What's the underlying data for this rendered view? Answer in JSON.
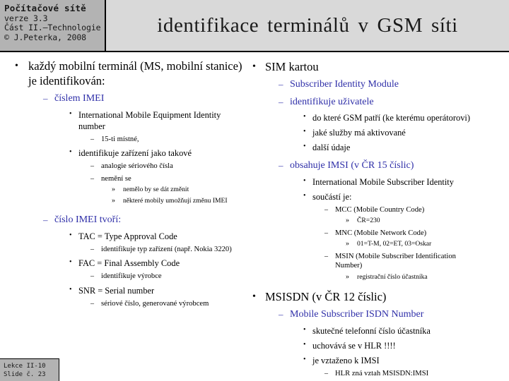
{
  "header": {
    "course_title": "Počítačové sítě",
    "course_lines": [
      "verze 3.3",
      "Část II.–Technologie",
      "© J.Peterka, 2008"
    ],
    "slide_title": "identifikace terminálů v GSM síti",
    "info_box_color": "#b3b3b3",
    "title_box_color": "#d9d9d9"
  },
  "colors": {
    "level2_blue": "#2e2ea8",
    "text_black": "#000000",
    "badge_gray": "#b3b3b3"
  },
  "bullets": {
    "lv1": "•",
    "lv2": "–",
    "lv3": "•",
    "lv4": "–",
    "lv5": "»"
  },
  "left_column": {
    "item_1": "každý mobilní terminál (MS, mobilní stanice) je identifikován:",
    "item_2": "číslem IMEI",
    "item_3": "International Mobile Equipment Identity number",
    "item_4": "15-ti místné,",
    "item_5": "identifikuje zařízení jako takové",
    "item_6": "analogie sériového čísla",
    "item_7": "nemění se",
    "item_8": "nemělo by se dát změnit",
    "item_9": "některé mobily umožňují změnu IMEI",
    "item_10": "číslo IMEI tvoří:",
    "item_11": "TAC = Type Approval Code",
    "item_12": "identifikuje typ zařízení (např. Nokia 3220)",
    "item_13": "FAC = Final Assembly Code",
    "item_14": "identifikuje výrobce",
    "item_15": "SNR = Serial number",
    "item_16": "sériové číslo, generované výrobcem"
  },
  "right_column": {
    "item_1": "SIM kartou",
    "item_2": "Subscriber Identity Module",
    "item_3": "identifikuje uživatele",
    "item_4": "do které GSM patří (ke kterému operátorovi)",
    "item_5": "jaké služby má aktivované",
    "item_6": "další údaje",
    "item_7": "obsahuje IMSI  (v ČR 15 číslic)",
    "item_8": "International Mobile Subscriber Identity",
    "item_9": "součástí je:",
    "item_10": "MCC (Mobile Country Code)",
    "item_11": "ČR=230",
    "item_12": "MNC (Mobile Network Code)",
    "item_13": "01=T-M, 02=ET, 03=Oskar",
    "item_14": "MSIN (Mobile Subscriber Identification Number)",
    "item_15": "registrační číslo účastníka",
    "item_16": "MSISDN (v ČR 12 číslic)",
    "item_17": "Mobile Subscriber ISDN Number",
    "item_18": "skutečné telefonní číslo účastníka",
    "item_19": "uchovává se v HLR !!!!",
    "item_20": "je vztaženo k IMSI",
    "item_21": "HLR zná vztah MSISDN:IMSI"
  },
  "footer": {
    "line_1": "Lekce II-10",
    "line_2": "Slide č. 23"
  }
}
